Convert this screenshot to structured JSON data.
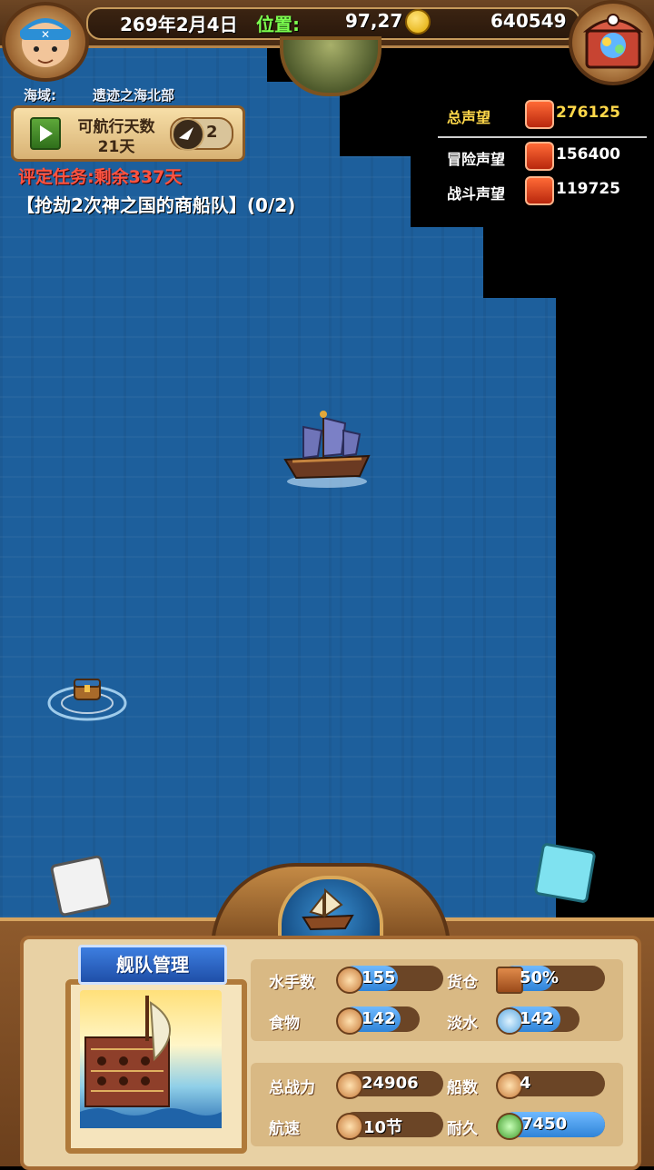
{
  "topbar": {
    "date": "269年2月4日",
    "position_label": "位置:",
    "position_value": "97,27",
    "gold": "640549"
  },
  "sea_area": {
    "label": "海域:",
    "value": "遗迹之海北部"
  },
  "navigation": {
    "days_label": "可航行天数",
    "days_value": "21天",
    "speed_multiplier": "2"
  },
  "task": {
    "deadline": "评定任务:剩余337天",
    "objective": "【抢劫2次神之国的商船队】(0/2)"
  },
  "reputation": {
    "total_label": "总声望",
    "total_value": "276125",
    "adventure_label": "冒险声望",
    "adventure_value": "156400",
    "battle_label": "战斗声望",
    "battle_value": "119725"
  },
  "fleet": {
    "title": "舰队管理",
    "stats": {
      "sailors_label": "水手数",
      "sailors_value": "155",
      "sailors_fill": 0.55,
      "cargo_label": "货仓",
      "cargo_value": "50%",
      "cargo_fill": 0.5,
      "food_label": "食物",
      "food_value": "142",
      "food_fill": 0.75,
      "water_label": "淡水",
      "water_value": "142",
      "water_fill": 0.75,
      "power_label": "总战力",
      "power_value": "24906",
      "ships_label": "船数",
      "ships_value": "4",
      "speed_label": "航速",
      "speed_value": "10节",
      "durability_label": "耐久",
      "durability_value": "7450",
      "durability_fill": 1.0
    }
  },
  "icons": {
    "avatar": "pirate-avatar-icon",
    "chest": "treasure-chest-icon",
    "coin": "gold-coin-icon",
    "globe": "world-map-icon"
  },
  "colors": {
    "sea": "#1d5f9c",
    "task_red": "#ff5340",
    "rep_total": "#ffd84a",
    "panel_wood": "#8e5a2c",
    "bar_blue": "#2f84d8"
  }
}
